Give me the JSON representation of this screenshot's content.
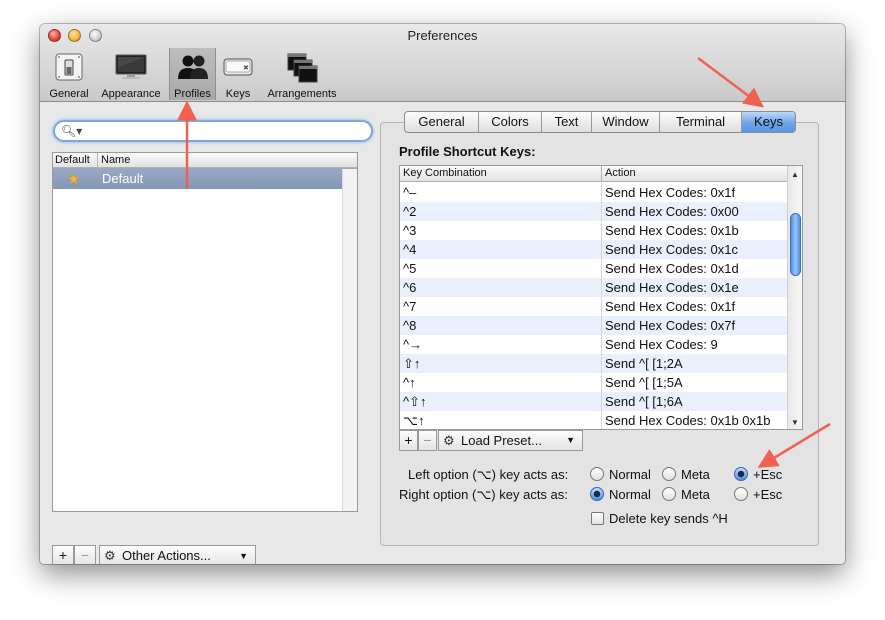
{
  "window": {
    "title": "Preferences"
  },
  "toolbar": {
    "items": [
      {
        "label": "General",
        "icon": "switch-icon"
      },
      {
        "label": "Appearance",
        "icon": "monitor-icon"
      },
      {
        "label": "Profiles",
        "icon": "people-icon",
        "selected": true
      },
      {
        "label": "Keys",
        "icon": "keyboard-key-icon"
      },
      {
        "label": "Arrangements",
        "icon": "windows-icon"
      }
    ]
  },
  "sidebar": {
    "search": {
      "value": ""
    },
    "columns": [
      "Default",
      "Name"
    ],
    "profiles": [
      {
        "name": "Default",
        "is_default": true,
        "selected": true
      }
    ],
    "add_label": "+",
    "remove_label": "−",
    "actions_label": "Other Actions..."
  },
  "tabs": [
    "General",
    "Colors",
    "Text",
    "Window",
    "Terminal",
    "Keys"
  ],
  "active_tab": "Keys",
  "shortcuts": {
    "title": "Profile Shortcut Keys:",
    "columns": [
      "Key Combination",
      "Action"
    ],
    "rows": [
      {
        "key": "^–",
        "action": "Send Hex Codes: 0x1f"
      },
      {
        "key": "^2",
        "action": "Send Hex Codes: 0x00"
      },
      {
        "key": "^3",
        "action": "Send Hex Codes: 0x1b"
      },
      {
        "key": "^4",
        "action": "Send Hex Codes: 0x1c"
      },
      {
        "key": "^5",
        "action": "Send Hex Codes: 0x1d"
      },
      {
        "key": "^6",
        "action": "Send Hex Codes: 0x1e"
      },
      {
        "key": "^7",
        "action": "Send Hex Codes: 0x1f"
      },
      {
        "key": "^8",
        "action": "Send Hex Codes: 0x7f"
      },
      {
        "key": "^→",
        "action": "Send Hex Codes: 9"
      },
      {
        "key": "⇧↑",
        "action": "Send ^[ [1;2A"
      },
      {
        "key": "^↑",
        "action": "Send ^[ [1;5A"
      },
      {
        "key": "^⇧↑",
        "action": "Send ^[ [1;6A"
      },
      {
        "key": "⌥↑",
        "action": "Send Hex Codes: 0x1b 0x1b"
      }
    ],
    "add_label": "+",
    "remove_label": "−",
    "preset_label": "Load Preset..."
  },
  "options": {
    "left": {
      "label": "Left option (⌥) key acts as:",
      "choices": [
        "Normal",
        "Meta",
        "+Esc"
      ],
      "selected": "+Esc"
    },
    "right": {
      "label": "Right option (⌥) key acts as:",
      "choices": [
        "Normal",
        "Meta",
        "+Esc"
      ],
      "selected": "Normal"
    },
    "delete_key": {
      "label": "Delete key sends ^H",
      "checked": false
    }
  },
  "colors": {
    "annotation_arrow": "#f0614f",
    "selection_blue": "#5b95e2",
    "row_alt": "#e9f0fb"
  }
}
